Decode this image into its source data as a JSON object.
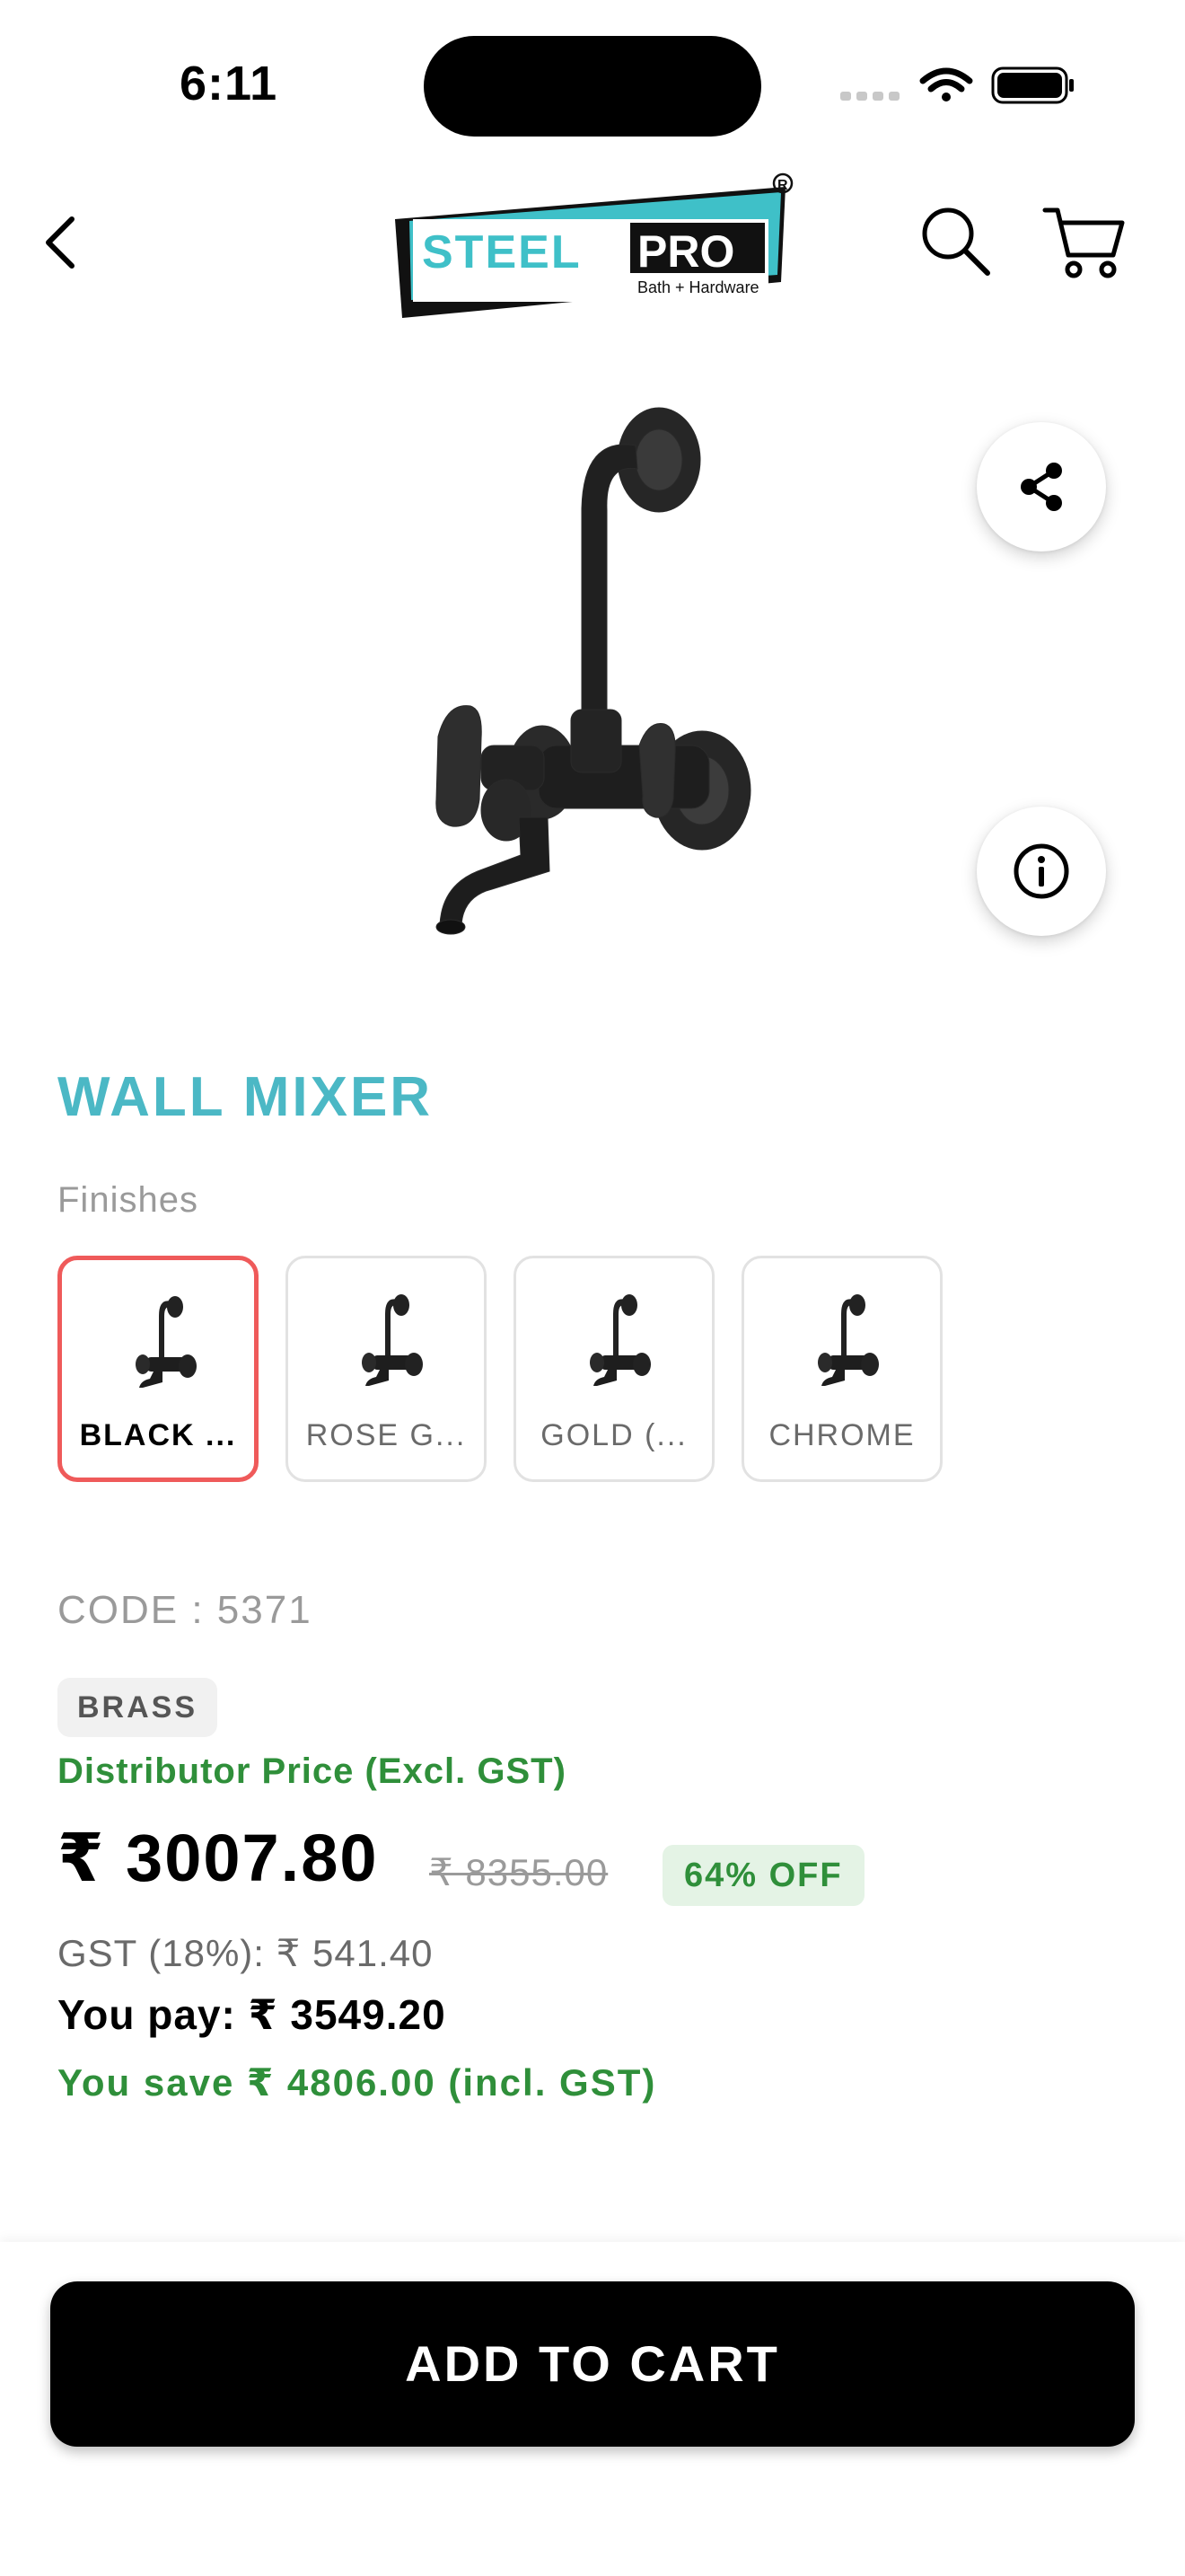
{
  "status_bar": {
    "time": "6:11",
    "icons": [
      "signal-icon",
      "wifi-icon",
      "battery-icon"
    ]
  },
  "header": {
    "back_icon": "chevron-left-icon",
    "logo": {
      "brand": "STEELPRO",
      "tagline": "Bath + Hardware",
      "registered_mark": "®"
    },
    "search_icon": "search-icon",
    "cart_icon": "cart-icon"
  },
  "product": {
    "image_icon": "wall-mixer-product-image",
    "share_icon": "share-icon",
    "info_icon": "info-icon",
    "title": "WALL MIXER",
    "finishes_label": "Finishes",
    "finishes": [
      {
        "label": "BLACK ...",
        "selected": true
      },
      {
        "label": "ROSE G...",
        "selected": false
      },
      {
        "label": "GOLD (...",
        "selected": false
      },
      {
        "label": "CHROME",
        "selected": false
      }
    ],
    "code": "CODE : 5371",
    "material": "BRASS",
    "price_label": "Distributor Price (Excl. GST)",
    "price": "₹ 3007.80",
    "mrp": "₹ 8355.00",
    "discount": "64% OFF",
    "gst": "GST (18%): ₹ 541.40",
    "you_pay": "You pay: ₹ 3549.20",
    "you_save": "You save ₹ 4806.00 (incl. GST)"
  },
  "actions": {
    "add_to_cart": "ADD TO CART"
  },
  "colors": {
    "accent_title": "#4bb8c5",
    "selected_border": "#ef5a5a",
    "success_green": "#2f8f3a",
    "button_bg": "#000000"
  }
}
